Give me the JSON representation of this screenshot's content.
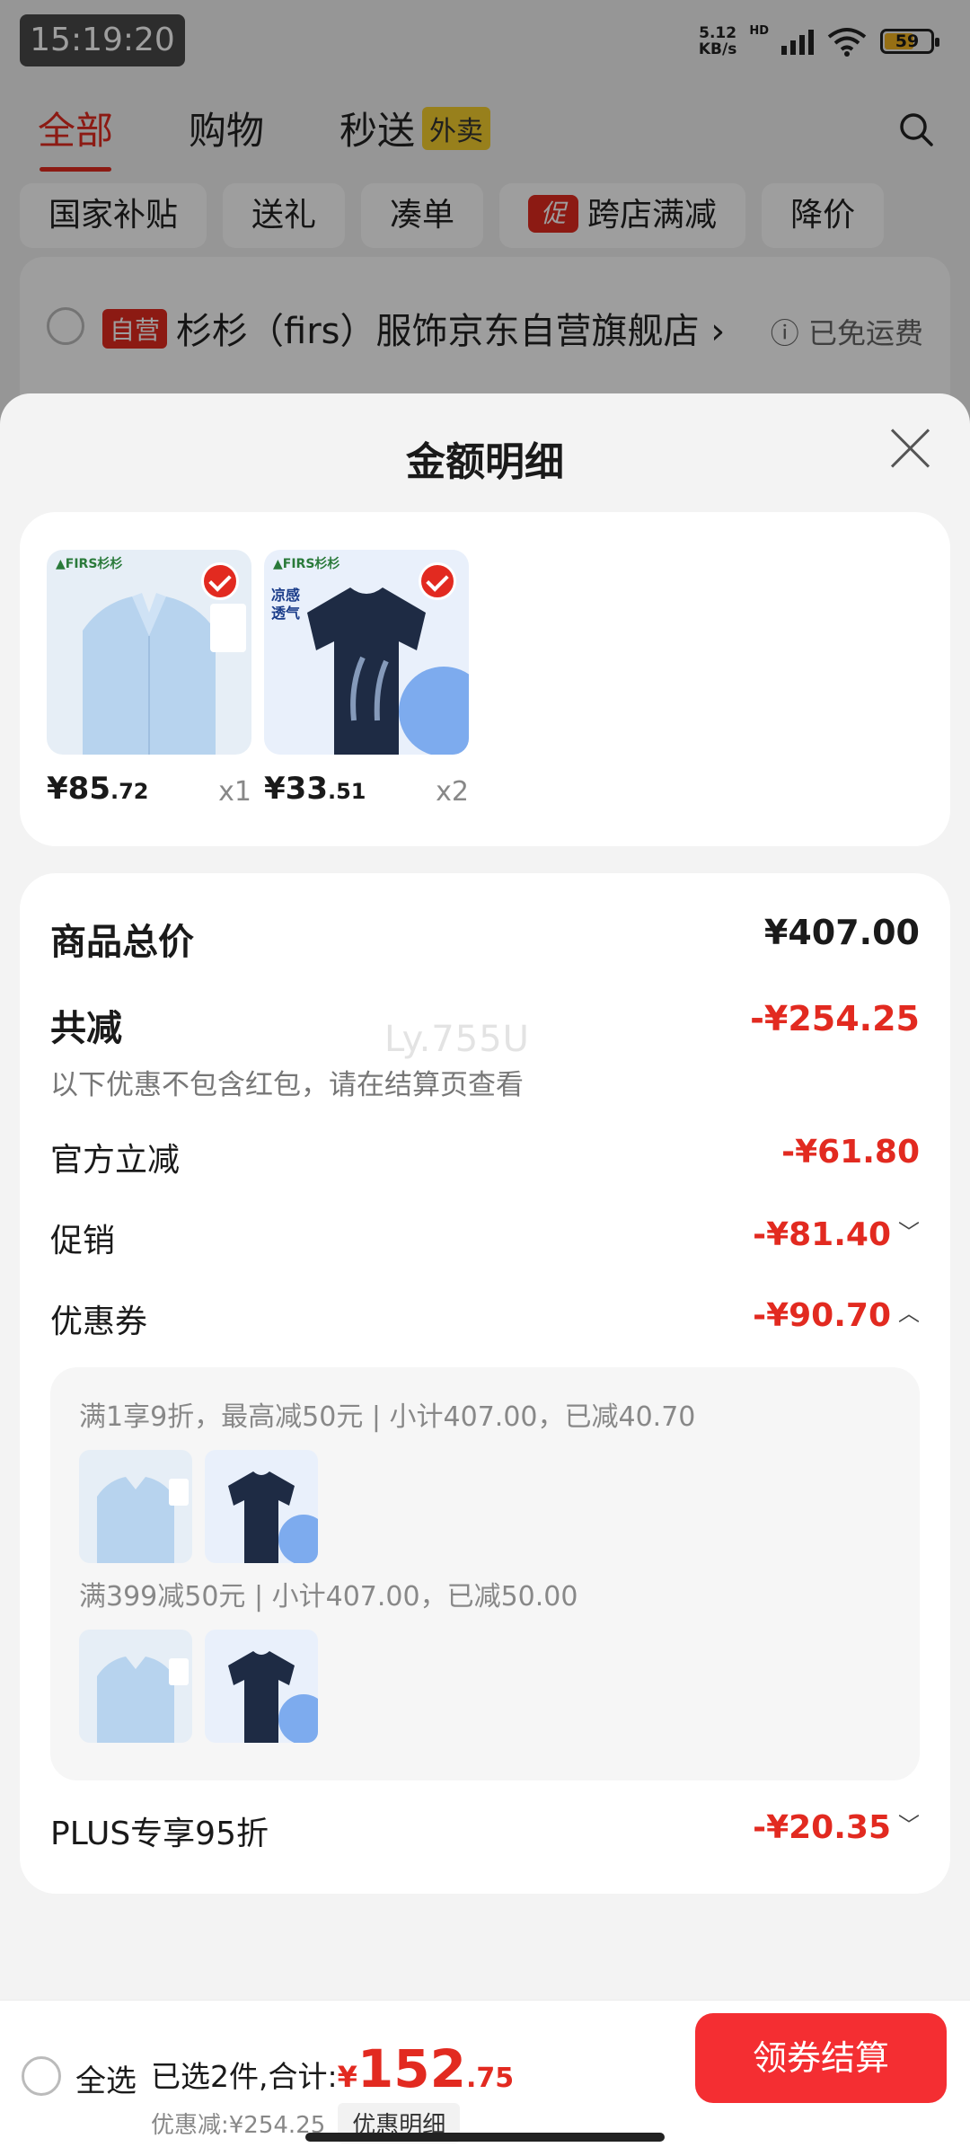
{
  "status": {
    "time": "15:19:20",
    "net_speed_value": "5.12",
    "net_speed_unit": "KB/s",
    "hd": "HD",
    "battery": "59"
  },
  "background": {
    "tabs": [
      {
        "label": "全部",
        "active": true
      },
      {
        "label": "购物",
        "active": false
      },
      {
        "label": "秒送",
        "active": false,
        "badge": "外卖"
      }
    ],
    "chips": [
      "国家补贴",
      "送礼",
      "凑单",
      "跨店满减",
      "降价"
    ],
    "chip_promo_badge": "促",
    "store": {
      "badge": "自营",
      "name": "杉杉（firs）服饰京东自营旗舰店",
      "shipping": "已免运费"
    }
  },
  "sheet": {
    "title": "金额明细",
    "products": [
      {
        "price_int": "¥85",
        "price_dec": ".72",
        "qty": "x1",
        "brand": "FIRS杉杉",
        "kind": "shirt",
        "selected": true
      },
      {
        "price_int": "¥33",
        "price_dec": ".51",
        "qty": "x2",
        "brand": "FIRS杉杉",
        "kind": "tee",
        "selected": true
      }
    ],
    "total_label": "商品总价",
    "total_value": "¥407.00",
    "reduce_label": "共减",
    "reduce_value": "-¥254.25",
    "reduce_note": "以下优惠不包含红包，请在结算页查看",
    "watermark": "Ly.755U",
    "official_label": "官方立减",
    "official_value": "-¥61.80",
    "promo_label": "促销",
    "promo_value": "-¥81.40",
    "coupon_label": "优惠券",
    "coupon_value": "-¥90.70",
    "coupon_details": [
      {
        "text": "满1享9折，最高减50元 | 小计407.00，已减40.70"
      },
      {
        "text": "满399减50元 | 小计407.00，已减50.00"
      }
    ],
    "plus_label": "PLUS专享95折",
    "plus_value": "-¥20.35"
  },
  "bottom": {
    "select_all": "全选",
    "summary_prefix": "已选2件,合计:",
    "currency": "¥",
    "total_int": "152",
    "total_dec": ".75",
    "discount": "优惠减:¥254.25",
    "detail_chip": "优惠明细",
    "checkout": "领券结算"
  },
  "colors": {
    "accent": "#e22a20",
    "checkout": "#f42e32",
    "waimai_badge": "#f6cf2e"
  }
}
